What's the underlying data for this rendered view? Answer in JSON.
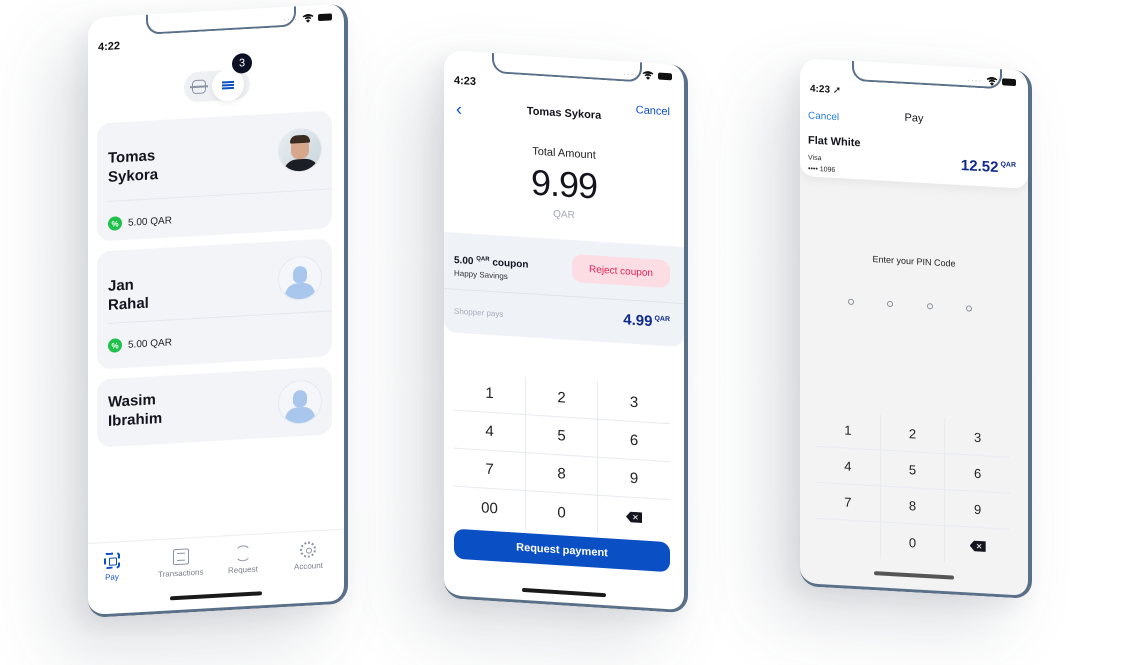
{
  "phone1": {
    "time": "4:22",
    "badge_count": "3",
    "contacts": [
      {
        "first": "Tomas",
        "last": "Sykora",
        "coupon": "5.00 QAR",
        "avatar": "photo"
      },
      {
        "first": "Jan",
        "last": "Rahal",
        "coupon": "5.00 QAR",
        "avatar": "placeholder"
      },
      {
        "first": "Wasim",
        "last": "Ibrahim",
        "coupon": null,
        "avatar": "placeholder"
      }
    ],
    "coupon_icon": "%",
    "tabs": [
      {
        "label": "Pay",
        "icon": "qr-scan-icon",
        "active": true
      },
      {
        "label": "Transactions",
        "icon": "list-icon",
        "active": false
      },
      {
        "label": "Request",
        "icon": "refresh-icon",
        "active": false
      },
      {
        "label": "Account",
        "icon": "gear-icon",
        "active": false
      }
    ]
  },
  "phone2": {
    "time": "4:23",
    "nav_title": "Tomas Sykora",
    "back_glyph": "‹",
    "cancel_label": "Cancel",
    "total_label": "Total Amount",
    "total_value": "9.99",
    "currency": "QAR",
    "coupon_amount": "5.00",
    "coupon_currency": "QAR",
    "coupon_word": "coupon",
    "coupon_name": "Happy Savings",
    "reject_label": "Reject coupon",
    "shopper_pays_label": "Shopper pays",
    "shopper_pays_value": "4.99",
    "keys": [
      "1",
      "2",
      "3",
      "4",
      "5",
      "6",
      "7",
      "8",
      "9",
      "00",
      "0",
      "⌫"
    ],
    "request_label": "Request payment"
  },
  "phone3": {
    "time": "4:23 ➚",
    "cancel_label": "Cancel",
    "title": "Pay",
    "item": "Flat White",
    "card_type": "Visa",
    "card_number": "•••• 1096",
    "amount": "12.52",
    "currency": "QAR",
    "pin_label": "Enter your PIN Code",
    "pin_length": 4,
    "keys": [
      "1",
      "2",
      "3",
      "4",
      "5",
      "6",
      "7",
      "8",
      "9",
      "",
      "0",
      "⌫"
    ]
  },
  "colors": {
    "primary": "#0b4fc4",
    "amount_navy": "#102a8c",
    "reject_bg": "#fcdde3",
    "reject_text": "#e3245a",
    "coupon_green": "#1fc14a",
    "frame": "#5a7088"
  }
}
